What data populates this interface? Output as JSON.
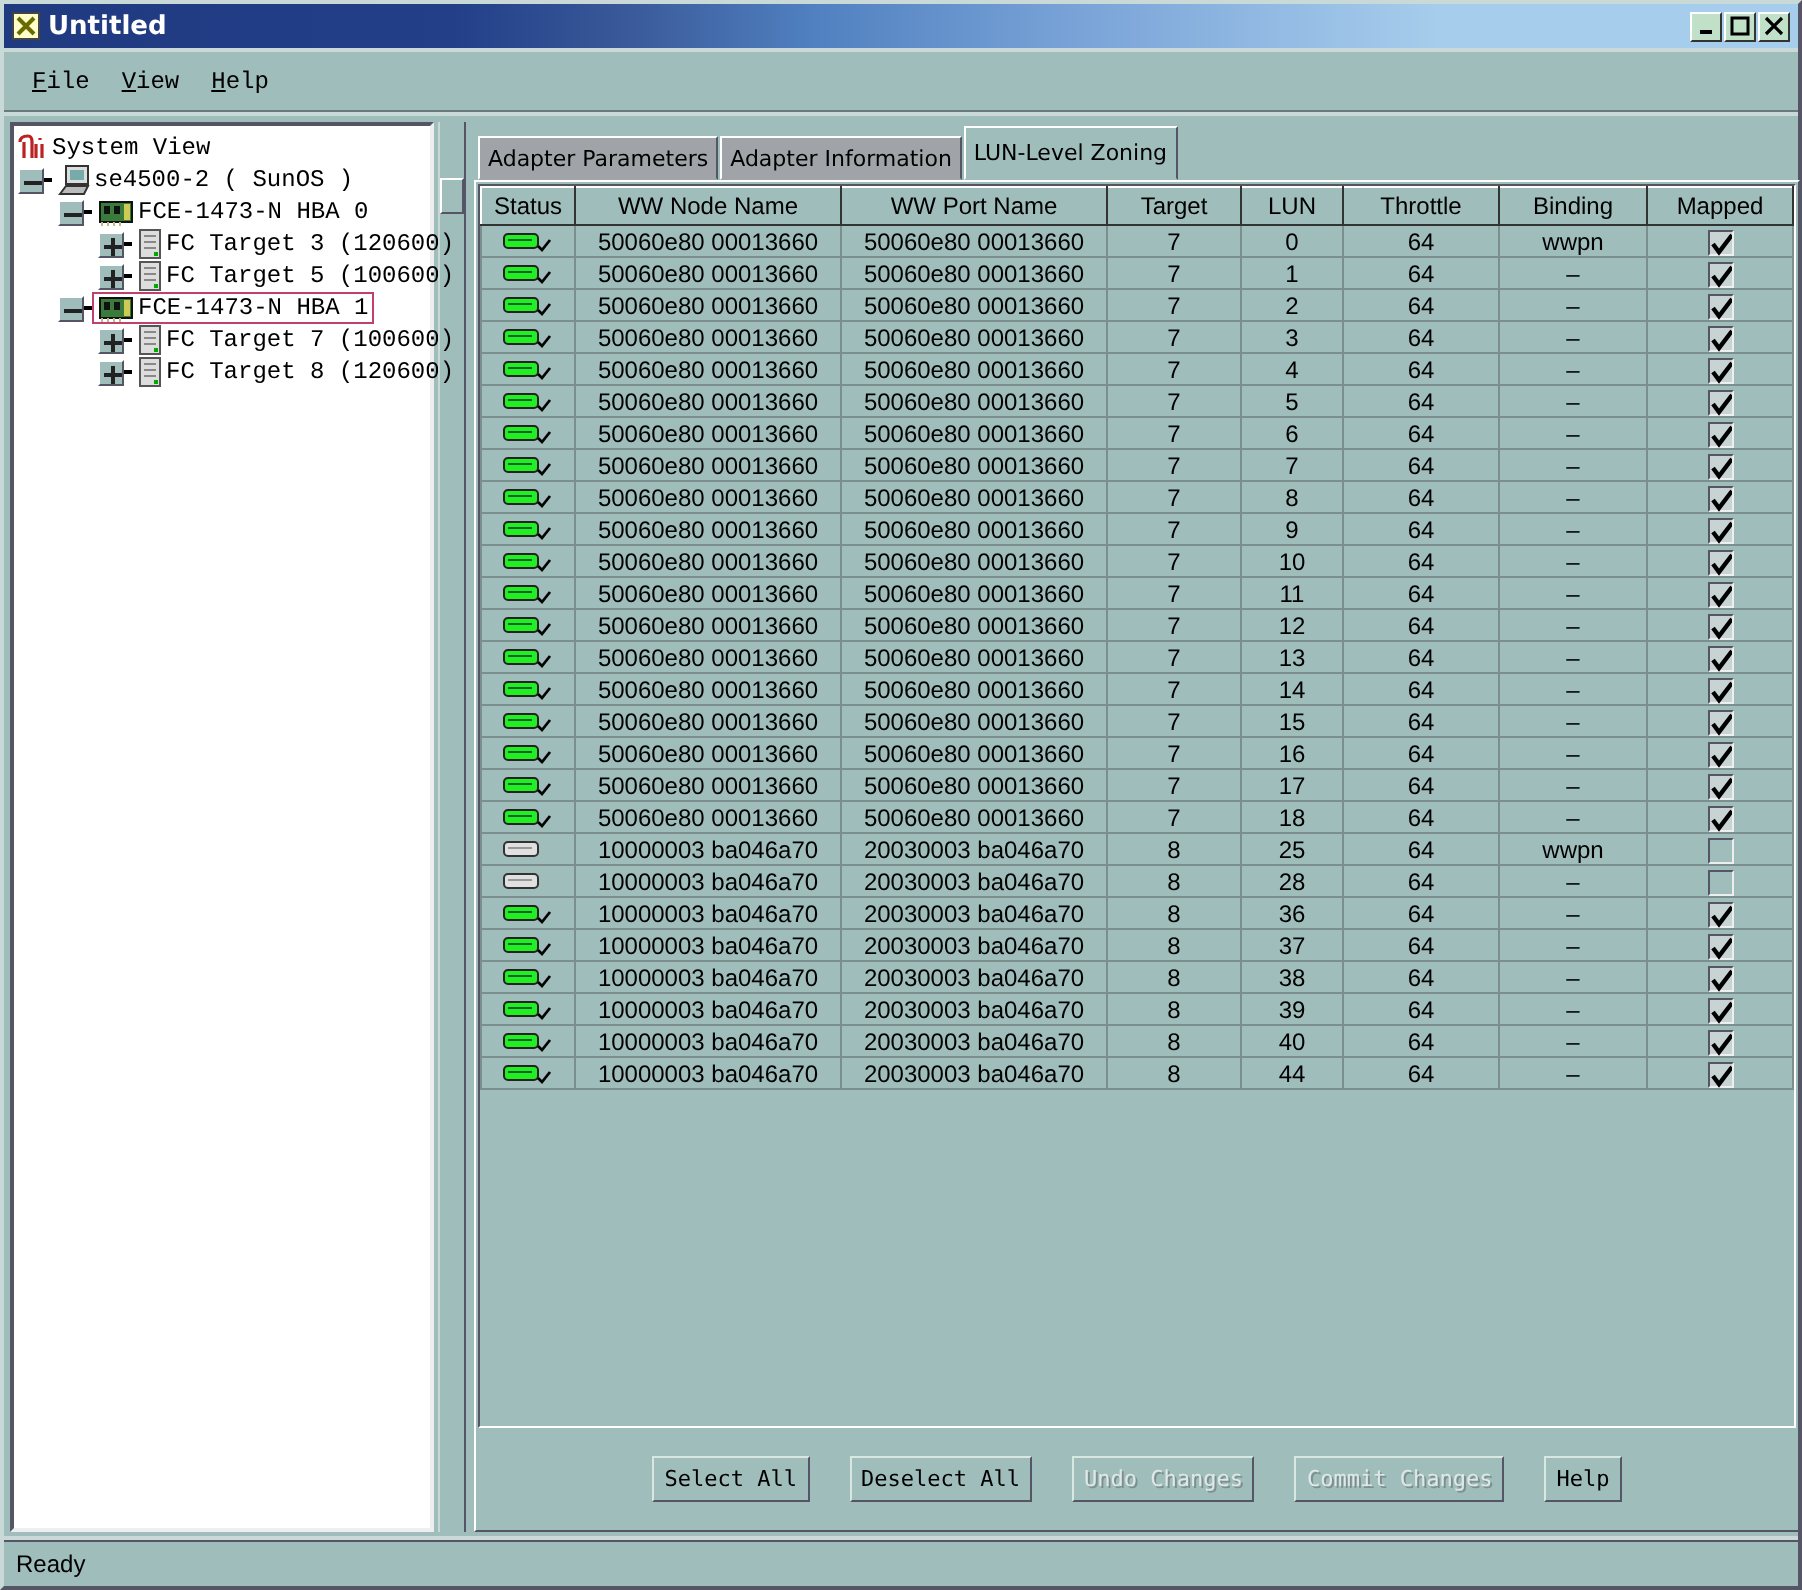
{
  "window": {
    "title": "Untitled"
  },
  "menu": [
    {
      "label": "File"
    },
    {
      "label": "View"
    },
    {
      "label": "Help"
    }
  ],
  "tree": {
    "label": "System View",
    "children": [
      {
        "label": "se4500-2 ( SunOS )",
        "kind": "host",
        "expanded": true,
        "selected": false,
        "children": [
          {
            "label": "FCE-1473-N HBA 0",
            "kind": "hba",
            "expanded": true,
            "selected": false,
            "children": [
              {
                "label": "FC Target 3 (120600)",
                "kind": "target",
                "expanded": false,
                "selected": false
              },
              {
                "label": "FC Target 5 (100600)",
                "kind": "target",
                "expanded": false,
                "selected": false
              }
            ]
          },
          {
            "label": "FCE-1473-N HBA 1",
            "kind": "hba",
            "expanded": true,
            "selected": true,
            "children": [
              {
                "label": "FC Target 7 (100600)",
                "kind": "target",
                "expanded": false,
                "selected": false
              },
              {
                "label": "FC Target 8 (120600)",
                "kind": "target",
                "expanded": false,
                "selected": false
              }
            ]
          }
        ]
      }
    ]
  },
  "tabs": [
    {
      "label": "Adapter Parameters",
      "selected": false
    },
    {
      "label": "Adapter Information",
      "selected": false
    },
    {
      "label": "LUN-Level Zoning",
      "selected": true
    }
  ],
  "table": {
    "columns": [
      "Status",
      "WW Node Name",
      "WW Port Name",
      "Target",
      "LUN",
      "Throttle",
      "Binding",
      "Mapped"
    ],
    "rows": [
      {
        "kind": "online",
        "node": "50060e80  00013660",
        "port": "50060e80  00013660",
        "target": "7",
        "lun": "0",
        "throttle": "64",
        "binding": "wwpn",
        "mapped": true
      },
      {
        "kind": "online",
        "node": "50060e80  00013660",
        "port": "50060e80  00013660",
        "target": "7",
        "lun": "1",
        "throttle": "64",
        "binding": "–",
        "mapped": true
      },
      {
        "kind": "online",
        "node": "50060e80  00013660",
        "port": "50060e80  00013660",
        "target": "7",
        "lun": "2",
        "throttle": "64",
        "binding": "–",
        "mapped": true
      },
      {
        "kind": "online",
        "node": "50060e80  00013660",
        "port": "50060e80  00013660",
        "target": "7",
        "lun": "3",
        "throttle": "64",
        "binding": "–",
        "mapped": true
      },
      {
        "kind": "online",
        "node": "50060e80  00013660",
        "port": "50060e80  00013660",
        "target": "7",
        "lun": "4",
        "throttle": "64",
        "binding": "–",
        "mapped": true
      },
      {
        "kind": "online",
        "node": "50060e80  00013660",
        "port": "50060e80  00013660",
        "target": "7",
        "lun": "5",
        "throttle": "64",
        "binding": "–",
        "mapped": true
      },
      {
        "kind": "online",
        "node": "50060e80  00013660",
        "port": "50060e80  00013660",
        "target": "7",
        "lun": "6",
        "throttle": "64",
        "binding": "–",
        "mapped": true
      },
      {
        "kind": "online",
        "node": "50060e80  00013660",
        "port": "50060e80  00013660",
        "target": "7",
        "lun": "7",
        "throttle": "64",
        "binding": "–",
        "mapped": true
      },
      {
        "kind": "online",
        "node": "50060e80  00013660",
        "port": "50060e80  00013660",
        "target": "7",
        "lun": "8",
        "throttle": "64",
        "binding": "–",
        "mapped": true
      },
      {
        "kind": "online",
        "node": "50060e80  00013660",
        "port": "50060e80  00013660",
        "target": "7",
        "lun": "9",
        "throttle": "64",
        "binding": "–",
        "mapped": true
      },
      {
        "kind": "online",
        "node": "50060e80  00013660",
        "port": "50060e80  00013660",
        "target": "7",
        "lun": "10",
        "throttle": "64",
        "binding": "–",
        "mapped": true
      },
      {
        "kind": "online",
        "node": "50060e80  00013660",
        "port": "50060e80  00013660",
        "target": "7",
        "lun": "11",
        "throttle": "64",
        "binding": "–",
        "mapped": true
      },
      {
        "kind": "online",
        "node": "50060e80  00013660",
        "port": "50060e80  00013660",
        "target": "7",
        "lun": "12",
        "throttle": "64",
        "binding": "–",
        "mapped": true
      },
      {
        "kind": "online",
        "node": "50060e80  00013660",
        "port": "50060e80  00013660",
        "target": "7",
        "lun": "13",
        "throttle": "64",
        "binding": "–",
        "mapped": true
      },
      {
        "kind": "online",
        "node": "50060e80  00013660",
        "port": "50060e80  00013660",
        "target": "7",
        "lun": "14",
        "throttle": "64",
        "binding": "–",
        "mapped": true
      },
      {
        "kind": "online",
        "node": "50060e80  00013660",
        "port": "50060e80  00013660",
        "target": "7",
        "lun": "15",
        "throttle": "64",
        "binding": "–",
        "mapped": true
      },
      {
        "kind": "online",
        "node": "50060e80  00013660",
        "port": "50060e80  00013660",
        "target": "7",
        "lun": "16",
        "throttle": "64",
        "binding": "–",
        "mapped": true
      },
      {
        "kind": "online",
        "node": "50060e80  00013660",
        "port": "50060e80  00013660",
        "target": "7",
        "lun": "17",
        "throttle": "64",
        "binding": "–",
        "mapped": true
      },
      {
        "kind": "online",
        "node": "50060e80  00013660",
        "port": "50060e80  00013660",
        "target": "7",
        "lun": "18",
        "throttle": "64",
        "binding": "–",
        "mapped": true
      },
      {
        "kind": "offline",
        "node": "10000003  ba046a70",
        "port": "20030003  ba046a70",
        "target": "8",
        "lun": "25",
        "throttle": "64",
        "binding": "wwpn",
        "mapped": false
      },
      {
        "kind": "offline",
        "node": "10000003  ba046a70",
        "port": "20030003  ba046a70",
        "target": "8",
        "lun": "28",
        "throttle": "64",
        "binding": "–",
        "mapped": false
      },
      {
        "kind": "online",
        "node": "10000003  ba046a70",
        "port": "20030003  ba046a70",
        "target": "8",
        "lun": "36",
        "throttle": "64",
        "binding": "–",
        "mapped": true
      },
      {
        "kind": "online",
        "node": "10000003  ba046a70",
        "port": "20030003  ba046a70",
        "target": "8",
        "lun": "37",
        "throttle": "64",
        "binding": "–",
        "mapped": true
      },
      {
        "kind": "online",
        "node": "10000003  ba046a70",
        "port": "20030003  ba046a70",
        "target": "8",
        "lun": "38",
        "throttle": "64",
        "binding": "–",
        "mapped": true
      },
      {
        "kind": "online",
        "node": "10000003  ba046a70",
        "port": "20030003  ba046a70",
        "target": "8",
        "lun": "39",
        "throttle": "64",
        "binding": "–",
        "mapped": true
      },
      {
        "kind": "online",
        "node": "10000003  ba046a70",
        "port": "20030003  ba046a70",
        "target": "8",
        "lun": "40",
        "throttle": "64",
        "binding": "–",
        "mapped": true
      },
      {
        "kind": "online",
        "node": "10000003  ba046a70",
        "port": "20030003  ba046a70",
        "target": "8",
        "lun": "44",
        "throttle": "64",
        "binding": "–",
        "mapped": true
      }
    ]
  },
  "buttons": [
    {
      "label": "Select All",
      "disabled": false
    },
    {
      "label": "Deselect All",
      "disabled": false
    },
    {
      "label": "Undo Changes",
      "disabled": true
    },
    {
      "label": "Commit Changes",
      "disabled": true
    },
    {
      "label": "Help",
      "disabled": false
    }
  ],
  "status_bar": "Ready"
}
